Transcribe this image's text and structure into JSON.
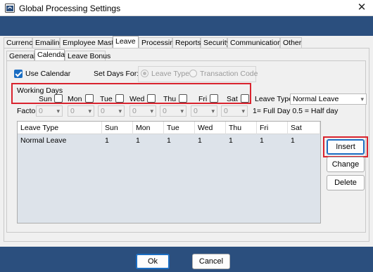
{
  "window": {
    "title": "Global Processing Settings",
    "close_glyph": "✕"
  },
  "main_tabs": [
    "Currency",
    "Emailing",
    "Employee Master",
    "Leave",
    "Processing",
    "Reports",
    "Security",
    "Communications",
    "Other"
  ],
  "main_tabs_active": "Leave",
  "sub_tabs": [
    "General",
    "Calendar",
    "Leave Bonus"
  ],
  "sub_tabs_active": "Calendar",
  "use_calendar": {
    "label": "Use Calendar",
    "checked": true
  },
  "set_days": {
    "label": "Set Days  For:",
    "options": [
      {
        "label": "Leave Type",
        "selected": true,
        "enabled": false
      },
      {
        "label": "Transaction Code",
        "selected": false,
        "enabled": false
      }
    ]
  },
  "working_days": {
    "label": "Working Days",
    "days": [
      "Sun",
      "Mon",
      "Tue",
      "Wed",
      "Thu",
      "Fri",
      "Sat"
    ]
  },
  "leave_type": {
    "label": "Leave Type:",
    "value": "Normal Leave"
  },
  "factor": {
    "label": "Factor:",
    "values": [
      "0",
      "0",
      "0",
      "0",
      "0",
      "0",
      "0"
    ],
    "hint": "1= Full Day 0.5 = Half day"
  },
  "table": {
    "columns": [
      "Leave Type",
      "Sun",
      "Mon",
      "Tue",
      "Wed",
      "Thu",
      "Fri",
      "Sat"
    ],
    "rows": [
      [
        "Normal Leave",
        "1",
        "1",
        "1",
        "1",
        "1",
        "1",
        "1"
      ]
    ]
  },
  "buttons": {
    "insert": "Insert",
    "change": "Change",
    "delete": "Delete",
    "ok": "Ok",
    "cancel": "Cancel"
  },
  "colors": {
    "header_bar": "#2b4f7e",
    "highlight": "#d9232e",
    "accent": "#1a6dc2"
  },
  "icons": {
    "app": "settings-app-icon",
    "close": "close-icon",
    "dropdown": "chevron-down-icon"
  }
}
